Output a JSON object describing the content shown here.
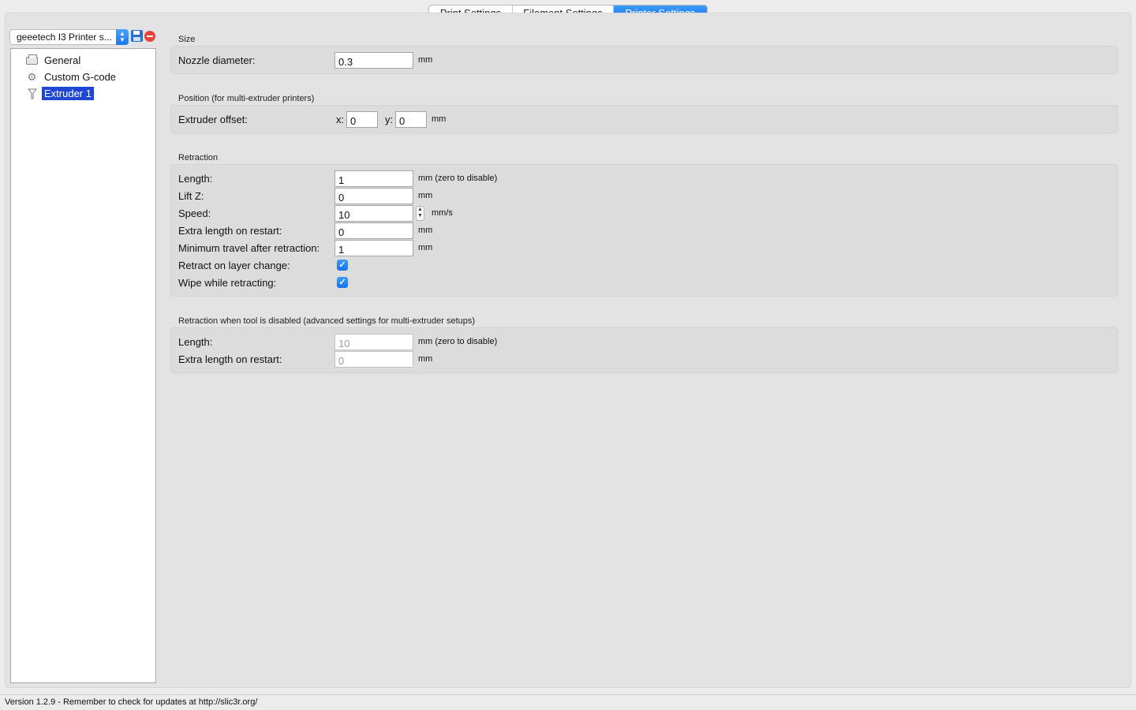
{
  "tabs": [
    {
      "label": "Print Settings",
      "active": false
    },
    {
      "label": "Filament Settings",
      "active": false
    },
    {
      "label": "Printer Settings",
      "active": true
    }
  ],
  "preset": {
    "value": "geeetech I3 Printer s..."
  },
  "tree": [
    {
      "label": "General",
      "icon": "printer-icon"
    },
    {
      "label": "Custom G-code",
      "icon": "gear-icon"
    },
    {
      "label": "Extruder 1",
      "icon": "funnel-icon",
      "selected": true
    }
  ],
  "size": {
    "title": "Size",
    "nozzle_label": "Nozzle diameter:",
    "nozzle_value": "0.3",
    "nozzle_unit": "mm"
  },
  "position": {
    "title": "Position (for multi-extruder printers)",
    "offset_label": "Extruder offset:",
    "x_label": "x:",
    "x_value": "0",
    "y_label": "y:",
    "y_value": "0",
    "unit": "mm"
  },
  "retraction": {
    "title": "Retraction",
    "length_label": "Length:",
    "length_value": "1",
    "length_unit": "mm (zero to disable)",
    "liftz_label": "Lift Z:",
    "liftz_value": "0",
    "liftz_unit": "mm",
    "speed_label": "Speed:",
    "speed_value": "10",
    "speed_unit": "mm/s",
    "extra_label": "Extra length on restart:",
    "extra_value": "0",
    "extra_unit": "mm",
    "mintravel_label": "Minimum travel after retraction:",
    "mintravel_value": "1",
    "mintravel_unit": "mm",
    "layerchange_label": "Retract on layer change:",
    "layerchange_checked": true,
    "wipe_label": "Wipe while retracting:",
    "wipe_checked": true
  },
  "toolchange": {
    "title": "Retraction when tool is disabled (advanced settings for multi-extruder setups)",
    "length_label": "Length:",
    "length_value": "10",
    "length_unit": "mm (zero to disable)",
    "extra_label": "Extra length on restart:",
    "extra_value": "0",
    "extra_unit": "mm"
  },
  "status": {
    "text": "Version 1.2.9 - Remember to check for updates at http://slic3r.org/"
  },
  "colors": {
    "accent": "#1a76f0",
    "selection": "#1f47d6"
  }
}
